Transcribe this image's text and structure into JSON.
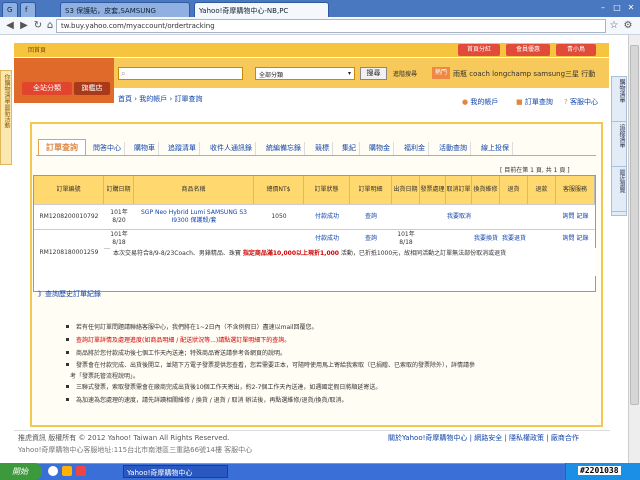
{
  "browser": {
    "tabs": [
      {
        "label": "G"
      },
      {
        "label": "f"
      },
      {
        "label": "S3 保護貼，皮套,SAMSUNG"
      },
      {
        "label": "Yahoo!奇摩購物中心-NB,PC"
      }
    ],
    "url": "tw.buy.yahoo.com/myaccount/ordertracking"
  },
  "left_panel": "你購物清單最新活動",
  "right_panel": [
    "購物清單",
    "追蹤清單",
    "最近瀏覽"
  ],
  "header": {
    "top_buttons": [
      "首頁分紅",
      "會員優惠",
      "青小鳥"
    ],
    "return_link": "回首頁",
    "btn_all_category": "全站分類",
    "btn_flagship": "旗艦店",
    "search_placeholder": "",
    "category_select": "全部分類",
    "search_button": "搜尋",
    "advanced_search": "進階搜尋",
    "hot_label": "熱門",
    "hot_words": "雨瓶  coach  longchamp  samsung三星  行動"
  },
  "breadcrumb": "首頁 › 我的帳戶 › 訂單查詢",
  "account_links": [
    "我的帳戶",
    "訂單查詢",
    "客服中心"
  ],
  "tabs": [
    "訂單查詢",
    "問答中心",
    "購物車",
    "追蹤清單",
    "收件人通訊錄",
    "統編備忘錄",
    "競標",
    "集紀",
    "購物金",
    "福利金",
    "活動查詢",
    "線上投保"
  ],
  "page_info": "[ 目前在第 1 頁, 共 1 頁 ]",
  "table": {
    "headers": [
      "訂單編號",
      "訂購日期",
      "商品名稱",
      "總價NT$",
      "訂單狀態",
      "訂單明細",
      "出貨日期",
      "發票處理",
      "取消訂單",
      "換貨維修",
      "退貨",
      "退款",
      "客服服務"
    ],
    "rows": [
      {
        "order_no": "RM1208200010792",
        "date": "101年8/20",
        "product": "SGP Neo Hybrid Lumi SAMSUNG S3 I9300 保護殼/套",
        "total": "1050",
        "status": "付款成功",
        "detail": "查詢",
        "ship_date": "",
        "invoice": "",
        "cancel": "我要取消",
        "exchange": "",
        "return": "",
        "refund": "",
        "service": "詢問 記錄"
      },
      {
        "order_no": "RM1208180001259",
        "date": "101年8/18",
        "product": "",
        "total": "",
        "status": "付款成功",
        "detail": "查詢",
        "ship_date": "101年8/18",
        "invoice": "",
        "cancel": "",
        "exchange": "我要換貨",
        "return": "我要退貨",
        "refund": "",
        "service": "詢問 記錄"
      }
    ],
    "promo_prefix": "本次交易符合8/9-8/23Coach、男錶精品、珠寶 ",
    "promo_highlight": "指定商品滿10,000以上現折1,000",
    "promo_mid": " 活動，已折抵1000元",
    "promo_suffix": "，故相同活動之訂單無法部份取消或退貨"
  },
  "history_link": "》查詢歷史訂單紀錄",
  "notes": [
    "若有任何訂單問題請聯絡客服中心，我們將在1~2日內（不含例假日）盡速以mail回覆您。",
    "查詢訂單詳情及處理進度(如商品明細 / 配送狀況等...)請點選訂單明細下的查詢。",
    "商品將於您付款成功後七個工作天內送達；特殊商品寄送請參考各網頁的說明。",
    "發票會在付款完成、出貨後開立，並隨下方電子發票提供您查看，您若需要正本，可隨時使用馬上寄給我索取（已捐贈、已索取的發票除外），詳情請參",
    "考「發票託管流程說明」。",
    "三聯式發票，索取發票需會在廠商完成出貨後10個工作天寄出，約2-7個工作天內送達，如遇國定假日將順延寄送。",
    "為加速為您處理的速度，請先詳讀相關維修 / 換貨 / 退貨 / 取消 辦法後，再點選維修/退貨/換貨/取消。"
  ],
  "footer": {
    "copyright": "推虎資訊   版權所有 © 2012 Yahoo! Taiwan All Rights Reserved.",
    "links": "關於Yahoo!奇摩購物中心 | 網路安全 | 隱私權政策 | 廠商合作",
    "address": "Yahoo!奇摩購物中心客服地址:115台北市南港區三重路66號14樓  客服中心"
  },
  "taskbar": {
    "start": "開始",
    "app": "Yahoo!奇摩購物中心",
    "watermark": "#2201038"
  }
}
